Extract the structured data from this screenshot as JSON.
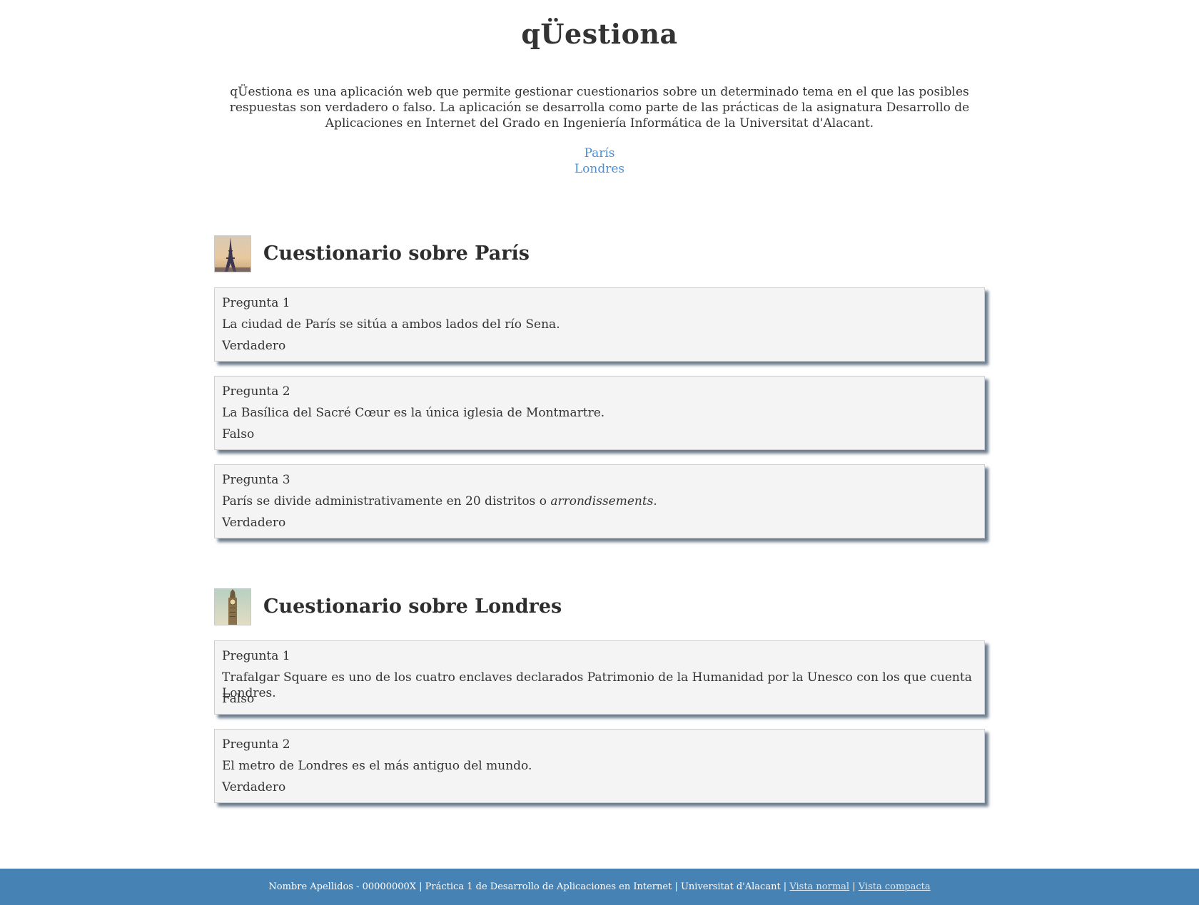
{
  "header": {
    "title": "qÜestiona",
    "intro": "qÜestiona es una aplicación web que permite gestionar cuestionarios sobre un determinado tema en el que las posibles respuestas son verdadero o falso. La aplicación se desarrolla como parte de las prácticas de la asignatura Desarrollo de Aplicaciones en Internet del Grado en Ingeniería Informática de la Universitat d'Alacant."
  },
  "nav": {
    "links": [
      "París",
      "Londres"
    ]
  },
  "quizzes": [
    {
      "title": "Cuestionario sobre París",
      "icon": "eiffel-tower-icon",
      "questions": [
        {
          "label": "Pregunta 1",
          "text": "La ciudad de París se sitúa a ambos lados del río Sena.",
          "answer": "Verdadero"
        },
        {
          "label": "Pregunta 2",
          "text": "La Basílica del Sacré Cœur es la única iglesia de Montmartre.",
          "answer": "Falso"
        },
        {
          "label": "Pregunta 3",
          "text_before": "París se divide administrativamente en 20 distritos o ",
          "text_em": "arrondissements",
          "text_after": ".",
          "answer": "Verdadero"
        }
      ]
    },
    {
      "title": "Cuestionario sobre Londres",
      "icon": "big-ben-icon",
      "questions": [
        {
          "label": "Pregunta 1",
          "text": "Trafalgar Square es uno de los cuatro enclaves declarados Patrimonio de la Humanidad por la Unesco con los que cuenta Londres.",
          "answer": "Falso"
        },
        {
          "label": "Pregunta 2",
          "text": "El metro de Londres es el más antiguo del mundo.",
          "answer": "Verdadero"
        }
      ]
    }
  ],
  "footer": {
    "info": "Nombre Apellidos - 00000000X | Práctica 1 de Desarrollo de Aplicaciones en Internet | Universitat d'Alacant |",
    "separator": "|",
    "link_normal": "Vista normal",
    "link_compact": "Vista compacta"
  },
  "colors": {
    "link": "#4a90d9",
    "footer_bg": "#4682b4",
    "card_bg": "#f4f4f4",
    "card_shadow": "#6e7e8e"
  }
}
